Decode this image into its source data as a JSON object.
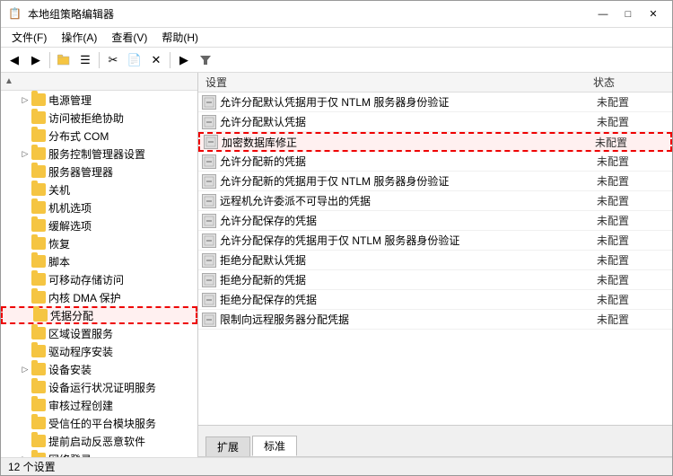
{
  "window": {
    "title": "本地组策略编辑器",
    "title_icon": "📋"
  },
  "menu": {
    "items": [
      "文件(F)",
      "操作(A)",
      "查看(V)",
      "帮助(H)"
    ]
  },
  "toolbar": {
    "buttons": [
      "◀",
      "▶",
      "📁",
      "☰",
      "✂",
      "📄",
      "✕",
      "▶",
      "🔧"
    ]
  },
  "tree": {
    "items": [
      {
        "indent": 1,
        "expand": "▷",
        "label": "电源管理",
        "selected": false,
        "highlighted": false
      },
      {
        "indent": 1,
        "expand": "",
        "label": "访问被拒绝协助",
        "selected": false,
        "highlighted": false
      },
      {
        "indent": 1,
        "expand": "",
        "label": "分布式 COM",
        "selected": false,
        "highlighted": false
      },
      {
        "indent": 1,
        "expand": "▷",
        "label": "服务控制管理器设置",
        "selected": false,
        "highlighted": false
      },
      {
        "indent": 1,
        "expand": "",
        "label": "服务器管理器",
        "selected": false,
        "highlighted": false
      },
      {
        "indent": 1,
        "expand": "",
        "label": "关机",
        "selected": false,
        "highlighted": false
      },
      {
        "indent": 1,
        "expand": "",
        "label": "机机选项",
        "selected": false,
        "highlighted": false
      },
      {
        "indent": 1,
        "expand": "",
        "label": "缓解选项",
        "selected": false,
        "highlighted": false
      },
      {
        "indent": 1,
        "expand": "",
        "label": "恢复",
        "selected": false,
        "highlighted": false
      },
      {
        "indent": 1,
        "expand": "",
        "label": "脚本",
        "selected": false,
        "highlighted": false
      },
      {
        "indent": 1,
        "expand": "",
        "label": "可移动存储访问",
        "selected": false,
        "highlighted": false
      },
      {
        "indent": 1,
        "expand": "",
        "label": "内核 DMA 保护",
        "selected": false,
        "highlighted": false
      },
      {
        "indent": 1,
        "expand": "",
        "label": "凭据分配",
        "selected": true,
        "highlighted": true
      },
      {
        "indent": 1,
        "expand": "",
        "label": "区域设置服务",
        "selected": false,
        "highlighted": false
      },
      {
        "indent": 1,
        "expand": "",
        "label": "驱动程序安装",
        "selected": false,
        "highlighted": false
      },
      {
        "indent": 1,
        "expand": "▷",
        "label": "设备安装",
        "selected": false,
        "highlighted": false
      },
      {
        "indent": 1,
        "expand": "",
        "label": "设备运行状况证明服务",
        "selected": false,
        "highlighted": false
      },
      {
        "indent": 1,
        "expand": "",
        "label": "审核过程创建",
        "selected": false,
        "highlighted": false
      },
      {
        "indent": 1,
        "expand": "",
        "label": "受信任的平台模块服务",
        "selected": false,
        "highlighted": false
      },
      {
        "indent": 1,
        "expand": "",
        "label": "提前启动反恶意软件",
        "selected": false,
        "highlighted": false
      },
      {
        "indent": 1,
        "expand": "▷",
        "label": "网络登录",
        "selected": false,
        "highlighted": false
      }
    ]
  },
  "right_panel": {
    "col_settings": "设置",
    "col_status": "状态",
    "rows": [
      {
        "name": "允许分配默认凭据用于仅 NTLM 服务器身份验证",
        "status": "未配置",
        "highlighted": false
      },
      {
        "name": "允许分配默认凭据",
        "status": "未配置",
        "highlighted": false
      },
      {
        "name": "加密数据库修正",
        "status": "未配置",
        "highlighted": true
      },
      {
        "name": "允许分配新的凭据",
        "status": "未配置",
        "highlighted": false
      },
      {
        "name": "允许分配新的凭据用于仅 NTLM 服务器身份验证",
        "status": "未配置",
        "highlighted": false
      },
      {
        "name": "远程机允许委派不可导出的凭据",
        "status": "未配置",
        "highlighted": false
      },
      {
        "name": "允许分配保存的凭据",
        "status": "未配置",
        "highlighted": false
      },
      {
        "name": "允许分配保存的凭据用于仅 NTLM 服务器身份验证",
        "status": "未配置",
        "highlighted": false
      },
      {
        "name": "拒绝分配默认凭据",
        "status": "未配置",
        "highlighted": false
      },
      {
        "name": "拒绝分配新的凭据",
        "status": "未配置",
        "highlighted": false
      },
      {
        "name": "拒绝分配保存的凭据",
        "status": "未配置",
        "highlighted": false
      },
      {
        "name": "限制向远程服务器分配凭据",
        "status": "未配置",
        "highlighted": false
      }
    ]
  },
  "tabs": [
    "扩展",
    "标准"
  ],
  "active_tab": "标准",
  "status_bar": {
    "text": "12 个设置"
  }
}
